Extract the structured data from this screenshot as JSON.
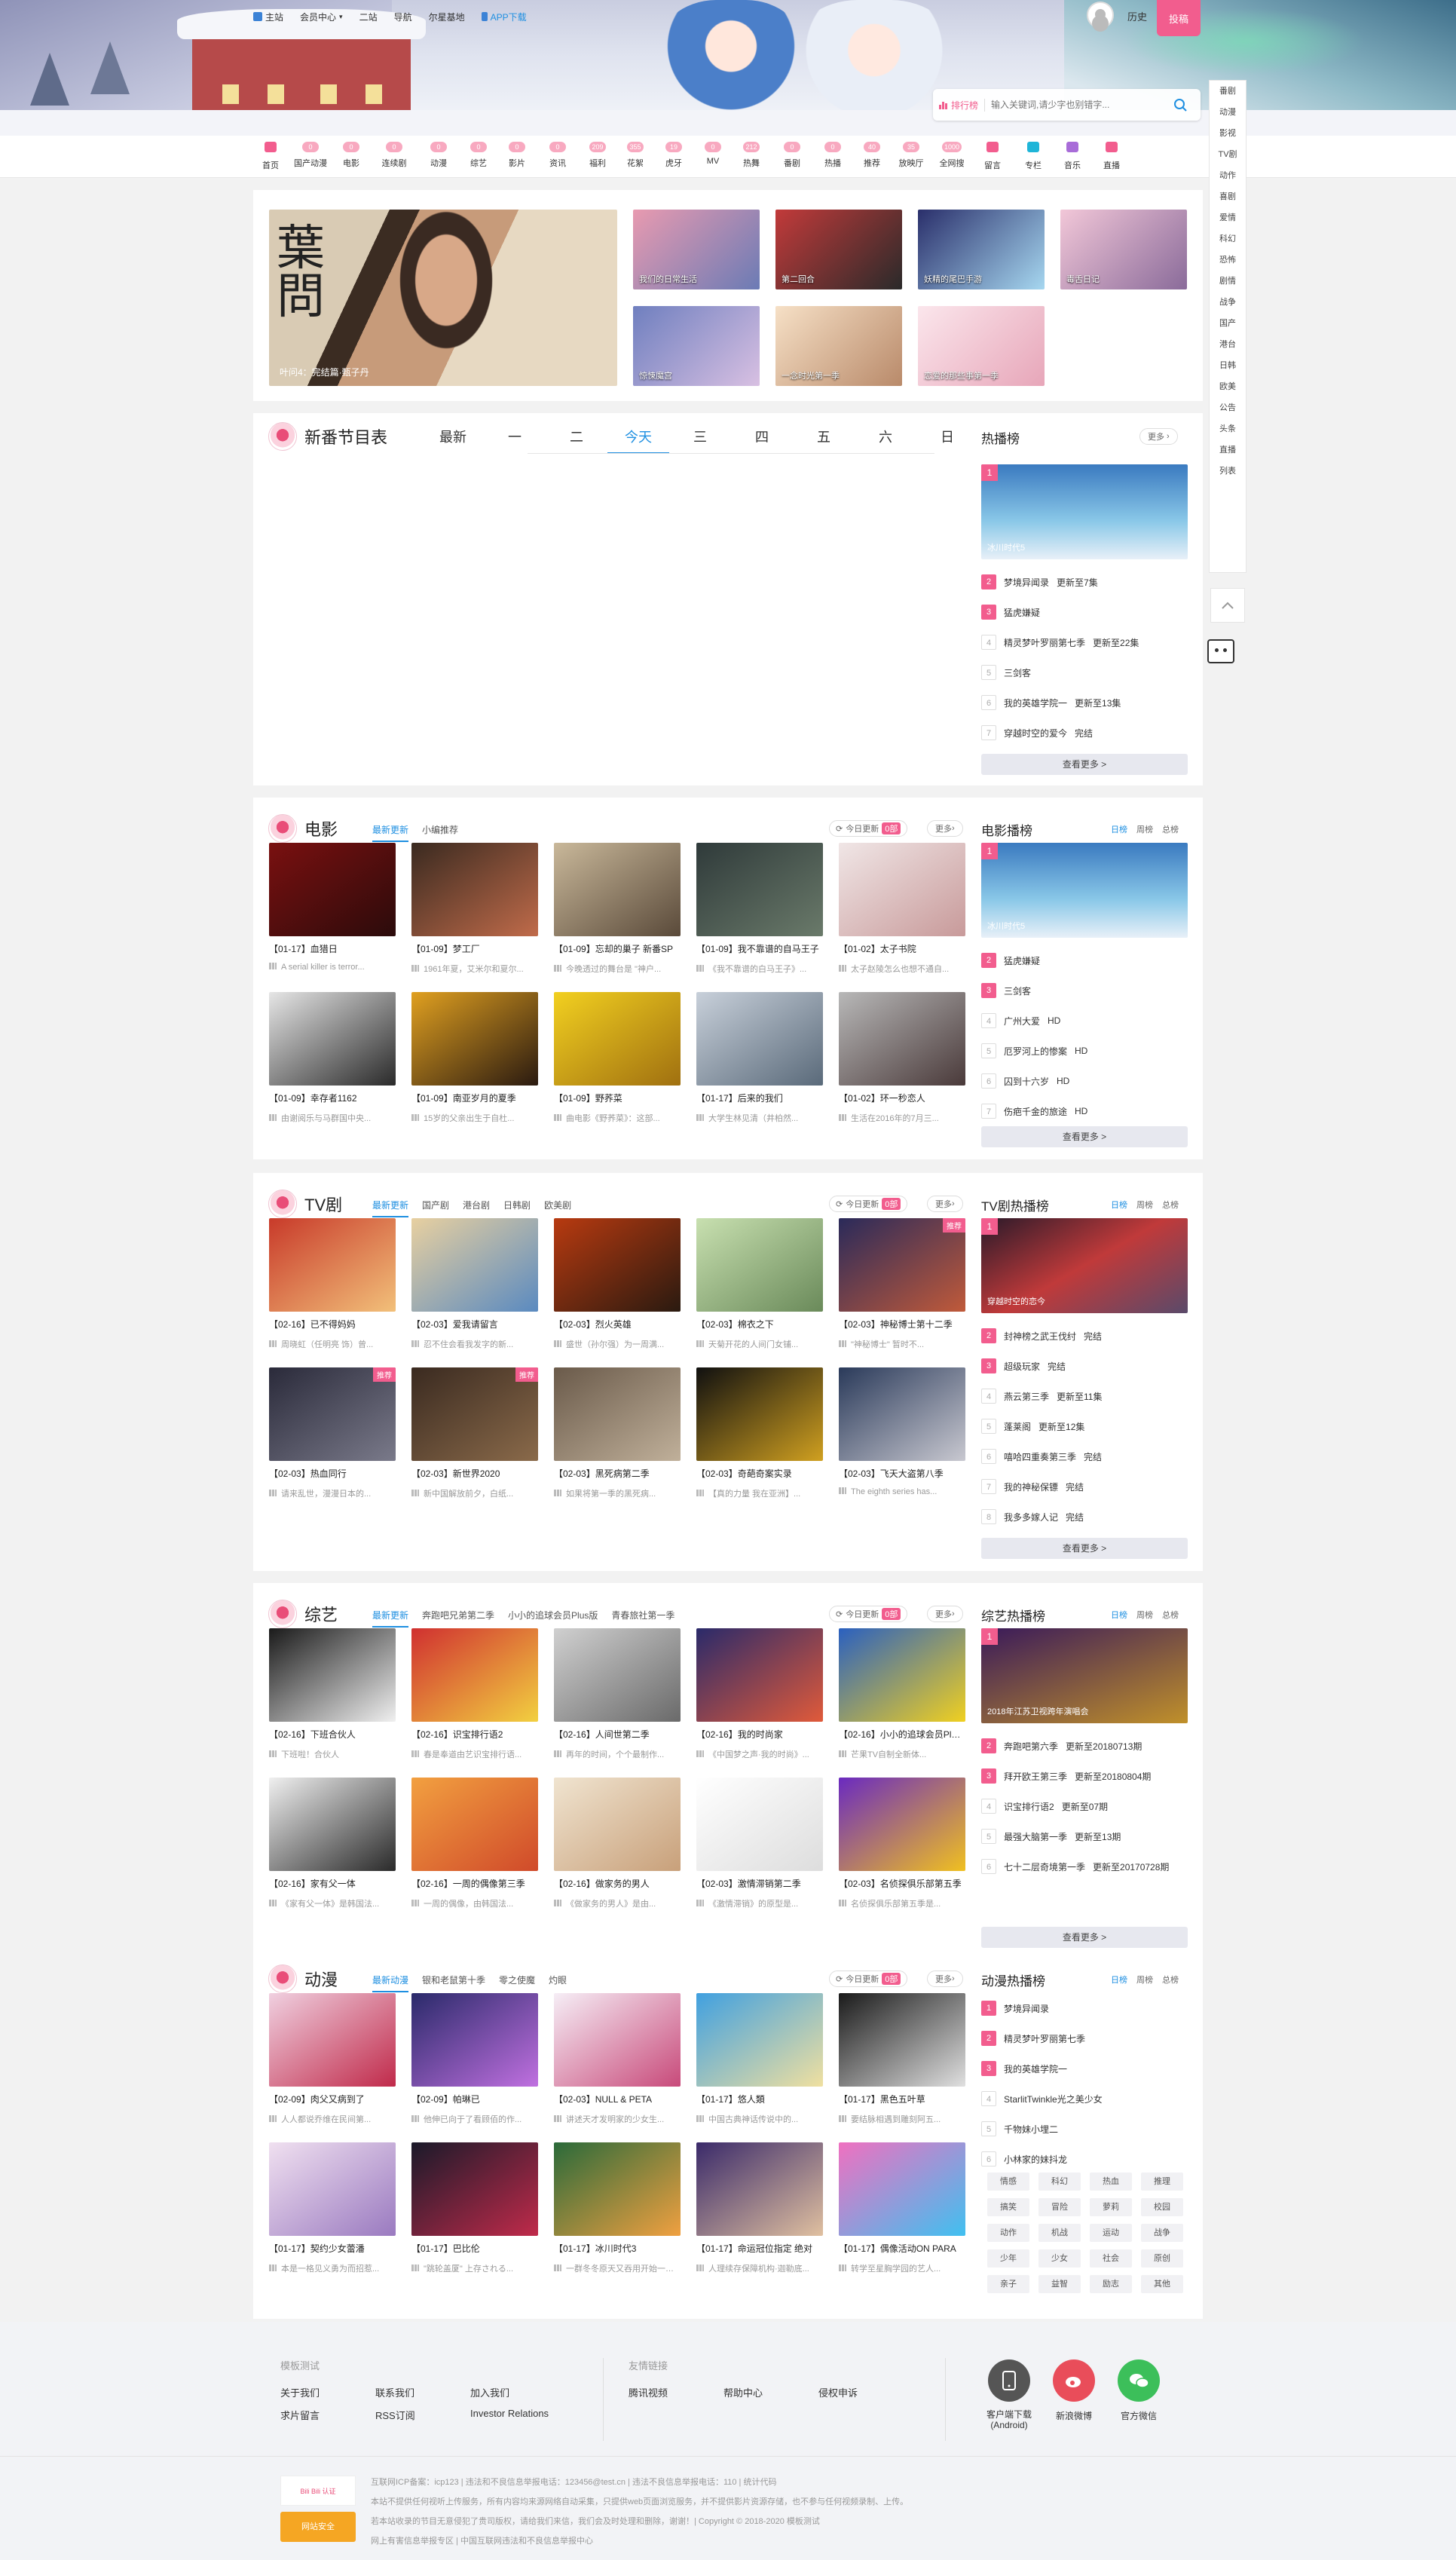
{
  "topnav": [
    {
      "label": "主站",
      "icon": "home-icon"
    },
    {
      "label": "会员中心"
    },
    {
      "label": "二站"
    },
    {
      "label": "导航"
    },
    {
      "label": "尔星基地"
    },
    {
      "label": "APP下载",
      "icon": "phone-icon"
    }
  ],
  "header": {
    "history": "历史",
    "post": "投稿",
    "rank_label": "排行榜",
    "search_placeholder": "输入关键词,请少字也别错字..."
  },
  "categories": [
    {
      "label": "首页",
      "badge": "",
      "color": "#f25d8e"
    },
    {
      "label": "国产动漫",
      "badge": "0",
      "color": ""
    },
    {
      "label": "电影",
      "badge": "0",
      "color": ""
    },
    {
      "label": "连续剧",
      "badge": "0",
      "color": ""
    },
    {
      "label": "动漫",
      "badge": "0",
      "color": ""
    },
    {
      "label": "综艺",
      "badge": "0",
      "color": ""
    },
    {
      "label": "影片",
      "badge": "0",
      "color": ""
    },
    {
      "label": "资讯",
      "badge": "0",
      "color": ""
    },
    {
      "label": "福利",
      "badge": "209",
      "color": ""
    },
    {
      "label": "花絮",
      "badge": "355",
      "color": ""
    },
    {
      "label": "虎牙",
      "badge": "19",
      "color": ""
    },
    {
      "label": "MV",
      "badge": "0",
      "color": ""
    },
    {
      "label": "热舞",
      "badge": "212",
      "color": ""
    },
    {
      "label": "番剧",
      "badge": "0",
      "color": ""
    },
    {
      "label": "热播",
      "badge": "0",
      "color": ""
    },
    {
      "label": "推荐",
      "badge": "40",
      "color": ""
    },
    {
      "label": "放映厅",
      "badge": "35",
      "color": ""
    },
    {
      "label": "全网搜",
      "badge": "1000",
      "color": ""
    },
    {
      "label": "留言",
      "badge": "",
      "color": "#f25d8e"
    },
    {
      "label": "专栏",
      "badge": "",
      "color": "#1fb5d8"
    },
    {
      "label": "音乐",
      "badge": "",
      "color": "#a86cd8"
    },
    {
      "label": "直播",
      "badge": "",
      "color": "#f25d8e"
    }
  ],
  "sidebar": [
    "番剧",
    "动漫",
    "影视",
    "TV剧",
    "动作",
    "喜剧",
    "爱情",
    "科幻",
    "恐怖",
    "剧情",
    "战争",
    "国产",
    "港台",
    "日韩",
    "欧美",
    "公告",
    "头条",
    "直播",
    "列表"
  ],
  "banner": {
    "main": {
      "caption": "叶问4：完结篇·甄子丹",
      "color": "#b58b6a"
    },
    "small": [
      {
        "caption": "我们的日常生活",
        "c1": "#e89ab0",
        "c2": "#6b7bb5"
      },
      {
        "caption": "第二回合",
        "c1": "#c23a3a",
        "c2": "#2a2a2a"
      },
      {
        "caption": "妖精的尾巴手游",
        "c1": "#2a2f6b",
        "c2": "#a6d7f0"
      },
      {
        "caption": "毒舌日记",
        "c1": "#f2c7d8",
        "c2": "#8a6b9a"
      },
      {
        "caption": "惊悚魔宫",
        "c1": "#6f7fbf",
        "c2": "#d8c0e2"
      },
      {
        "caption": "一念时光第一季",
        "c1": "#f6e0c6",
        "c2": "#b98a6a"
      },
      {
        "caption": "恋爱的那些事第一季",
        "c1": "#fbe6ec",
        "c2": "#e7a6b9"
      }
    ]
  },
  "schedule": {
    "title": "新番节目表",
    "tabs": [
      "最新",
      "一",
      "二",
      "今天",
      "三",
      "四",
      "五",
      "六",
      "日"
    ],
    "active": 3
  },
  "hot": {
    "title": "热播榜",
    "more": "更多",
    "top": {
      "caption": "冰川时代5"
    },
    "list": [
      {
        "n": "2",
        "title": "梦境异闻录",
        "ep": "更新至7集"
      },
      {
        "n": "3",
        "title": "猛虎嫌疑",
        "ep": ""
      },
      {
        "n": "4",
        "title": "精灵梦叶罗丽第七季",
        "ep": "更新至22集"
      },
      {
        "n": "5",
        "title": "三剑客",
        "ep": ""
      },
      {
        "n": "6",
        "title": "我的英雄学院一",
        "ep": "更新至13集"
      },
      {
        "n": "7",
        "title": "穿越时空的爱今",
        "ep": "完结"
      }
    ],
    "see_more": "查看更多 >"
  },
  "movie": {
    "title": "电影",
    "tabs": [
      "最新更新",
      "小编推荐"
    ],
    "refresh": "今日更新",
    "count": "0部",
    "more": "更多",
    "rank_title": "电影播榜",
    "rank_tabs": [
      "日榜",
      "周榜",
      "总榜"
    ],
    "items": [
      {
        "title": "【01-17】血猎日",
        "desc": "A serial killer is terror...",
        "c1": "#7a1010",
        "c2": "#2b0b0b",
        "tag": ""
      },
      {
        "title": "【01-09】梦工厂",
        "desc": "1961年夏，艾米尔和夏尔...",
        "c1": "#3a2a20",
        "c2": "#c06b4a",
        "tag": ""
      },
      {
        "title": "【01-09】忘却的巢子 新番SP",
        "desc": "今晚透过的舞台是 \"神户...",
        "c1": "#c9b89a",
        "c2": "#5a4a3a",
        "tag": ""
      },
      {
        "title": "【01-09】我不靠谱的自马王子",
        "desc": "《我不靠谱的白马王子》...",
        "c1": "#2f3a3a",
        "c2": "#6a7a6a",
        "tag": ""
      },
      {
        "title": "【01-02】太子书院",
        "desc": "太子赵陵怎么也想不通自...",
        "c1": "#f0e6e6",
        "c2": "#c89a9a",
        "tag": ""
      },
      {
        "title": "【01-09】幸存者1162",
        "desc": "由谢阅乐与马群国中央...",
        "c1": "#e6e6e6",
        "c2": "#2a2a2a",
        "tag": ""
      },
      {
        "title": "【01-09】南亚岁月的夏季",
        "desc": "15岁的父亲出生于自杜...",
        "c1": "#e0a020",
        "c2": "#2a1a10",
        "tag": ""
      },
      {
        "title": "【01-09】野荞菜",
        "desc": "曲电影《野荞菜》：这部...",
        "c1": "#f2d020",
        "c2": "#a07010",
        "tag": ""
      },
      {
        "title": "【01-17】后来的我们",
        "desc": "大学生林见清（井柏然...",
        "c1": "#c8d0da",
        "c2": "#5a6a7a",
        "tag": ""
      },
      {
        "title": "【01-02】环一秒恋人",
        "desc": "生活在2016年的7月三...",
        "c1": "#b8b8b8",
        "c2": "#4a3a3a",
        "tag": ""
      }
    ],
    "rank_top": {
      "caption": "冰川时代5"
    },
    "rank": [
      {
        "n": "2",
        "title": "猛虎嫌疑",
        "ep": ""
      },
      {
        "n": "3",
        "title": "三剑客",
        "ep": ""
      },
      {
        "n": "4",
        "title": "广州大爱",
        "ep": "HD"
      },
      {
        "n": "5",
        "title": "厄罗河上的惨案",
        "ep": "HD"
      },
      {
        "n": "6",
        "title": "囚到十六岁",
        "ep": "HD"
      },
      {
        "n": "7",
        "title": "伤疤千金的旅途",
        "ep": "HD"
      }
    ],
    "see_more": "查看更多 >"
  },
  "tv": {
    "title": "TV剧",
    "tabs": [
      "最新更新",
      "国产剧",
      "港台剧",
      "日韩剧",
      "欧美剧"
    ],
    "refresh": "今日更新",
    "count": "0部",
    "more": "更多",
    "rank_title": "TV剧热播榜",
    "rank_tabs": [
      "日榜",
      "周榜",
      "总榜"
    ],
    "items": [
      {
        "title": "【02-16】已不得妈妈",
        "desc": "周晓虹（任明亮 饰）曾...",
        "c1": "#c83a2a",
        "c2": "#f2c07a",
        "tag": ""
      },
      {
        "title": "【02-03】爱我请留言",
        "desc": "忍不住会看我发字的新...",
        "c1": "#e8d0a0",
        "c2": "#5a8ac0",
        "tag": ""
      },
      {
        "title": "【02-03】烈火英雄",
        "desc": "盛世（孙尔强）为一周满...",
        "c1": "#b83a10",
        "c2": "#2a1a10",
        "tag": ""
      },
      {
        "title": "【02-03】棉衣之下",
        "desc": "天菊开花的人间门女铺...",
        "c1": "#c8e0b0",
        "c2": "#6a8a5a",
        "tag": ""
      },
      {
        "title": "【02-03】神秘博士第十二季",
        "desc": "\"神秘博士\" 暂时不...",
        "c1": "#2a2a5a",
        "c2": "#c05a3a",
        "tag": "推荐"
      },
      {
        "title": "【02-03】热血同行",
        "desc": "请来乱世，漫漫日本的...",
        "c1": "#2a2a3a",
        "c2": "#7a7a8a",
        "tag": "推荐"
      },
      {
        "title": "【02-03】新世界2020",
        "desc": "新中国解放前夕，白纸...",
        "c1": "#3a2a20",
        "c2": "#8a6a4a",
        "tag": "推荐"
      },
      {
        "title": "【02-03】黑死病第二季",
        "desc": "如果将第一季的黑死病...",
        "c1": "#6a5a4a",
        "c2": "#c0b09a",
        "tag": ""
      },
      {
        "title": "【02-03】奇葩奇案实录",
        "desc": "【真的力量 我在亚洲】...",
        "c1": "#101010",
        "c2": "#d0a020",
        "tag": ""
      },
      {
        "title": "【02-03】飞天大盗第八季",
        "desc": "The eighth series has...",
        "c1": "#2a3a5a",
        "c2": "#c8c8d0",
        "tag": ""
      }
    ],
    "rank_top": {
      "caption": "穿越时空的恋今"
    },
    "rank": [
      {
        "n": "2",
        "title": "封神榜之武王伐纣",
        "ep": "完结"
      },
      {
        "n": "3",
        "title": "超级玩家",
        "ep": "完结"
      },
      {
        "n": "4",
        "title": "燕云第三季",
        "ep": "更新至11集"
      },
      {
        "n": "5",
        "title": "蓬莱阁",
        "ep": "更新至12集"
      },
      {
        "n": "6",
        "title": "嘻哈四重奏第三季",
        "ep": "完结"
      },
      {
        "n": "7",
        "title": "我的神秘保镖",
        "ep": "完结"
      },
      {
        "n": "8",
        "title": "我多多嫁人记",
        "ep": "完结"
      }
    ],
    "see_more": "查看更多 >"
  },
  "variety": {
    "title": "综艺",
    "tabs": [
      "最新更新",
      "奔跑吧兄弟第二季",
      "小小的追球会员Plus版",
      "青春旅社第一季"
    ],
    "refresh": "今日更新",
    "count": "0部",
    "more": "更多",
    "rank_title": "综艺热播榜",
    "rank_tabs": [
      "日榜",
      "周榜",
      "总榜"
    ],
    "items": [
      {
        "title": "【02-16】下班合伙人",
        "desc": "下班啦！合伙人",
        "c1": "#1a1a1a",
        "c2": "#f0f0f0",
        "tag": ""
      },
      {
        "title": "【02-16】识宝排行语2",
        "desc": "春是奉道由艺识宝排行语...",
        "c1": "#d03030",
        "c2": "#f2d040",
        "tag": ""
      },
      {
        "title": "【02-16】人间世第二季",
        "desc": "再年的时间，个个最制作...",
        "c1": "#d0d0d0",
        "c2": "#6a6a6a",
        "tag": ""
      },
      {
        "title": "【02-16】我的时尚家",
        "desc": "《中国梦之声·我的时尚》...",
        "c1": "#2a2a6a",
        "c2": "#e05a3a",
        "tag": ""
      },
      {
        "title": "【02-16】小小的追球会员Plus版",
        "desc": "芒果TV自制全新体...",
        "c1": "#2a60c0",
        "c2": "#f0d020",
        "tag": ""
      },
      {
        "title": "【02-16】家有父一体",
        "desc": "《家有父一体》是韩国法...",
        "c1": "#f0f0f0",
        "c2": "#2a2a2a",
        "tag": ""
      },
      {
        "title": "【02-16】一周的偶像第三季",
        "desc": "一周的偶像，由韩国法...",
        "c1": "#f2a040",
        "c2": "#d04a2a",
        "tag": ""
      },
      {
        "title": "【02-16】做家务的男人",
        "desc": "《做家务的男人》是由...",
        "c1": "#f0e4d0",
        "c2": "#c8a07a",
        "tag": ""
      },
      {
        "title": "【02-03】激情滞销第二季",
        "desc": "《激情滞销》的原型是...",
        "c1": "#ffffff",
        "c2": "#dddddd",
        "tag": ""
      },
      {
        "title": "【02-03】名侦探俱乐部第五季",
        "desc": "名侦探俱乐部第五季是...",
        "c1": "#6a2ac0",
        "c2": "#f0c020",
        "tag": ""
      }
    ],
    "rank_top": {
      "caption": "2018年江苏卫视跨年演唱会"
    },
    "rank": [
      {
        "n": "2",
        "title": "奔跑吧第六季",
        "ep": "更新至20180713期"
      },
      {
        "n": "3",
        "title": "拜开欧王第三季",
        "ep": "更新至20180804期"
      },
      {
        "n": "4",
        "title": "识宝排行语2",
        "ep": "更新至07期"
      },
      {
        "n": "5",
        "title": "最强大脑第一季",
        "ep": "更新至13期"
      },
      {
        "n": "6",
        "title": "七十二层奇境第一季",
        "ep": "更新至20170728期"
      }
    ],
    "see_more": "查看更多 >"
  },
  "anime": {
    "title": "动漫",
    "tabs": [
      "最新动漫",
      "银和老鼠第十季",
      "零之使魔",
      "灼眼"
    ],
    "refresh": "今日更新",
    "count": "0部",
    "more": "更多",
    "rank_title": "动漫热播榜",
    "rank_tabs": [
      "日榜",
      "周榜",
      "总榜"
    ],
    "items": [
      {
        "title": "【02-09】肉父又病到了",
        "desc": "人人都说乔维在民间第...",
        "c1": "#f0d0e0",
        "c2": "#c02a4a",
        "tag": ""
      },
      {
        "title": "【02-09】帕琳已",
        "desc": "他伸已向于了看顾佰的作...",
        "c1": "#2a2a6a",
        "c2": "#c070e0",
        "tag": ""
      },
      {
        "title": "【02-03】NULL & PETA",
        "desc": "讲述天才发明家的少女生...",
        "c1": "#f6eef6",
        "c2": "#c84a7a",
        "tag": ""
      },
      {
        "title": "【01-17】悠人類",
        "desc": "中国古典神话传说中的...",
        "c1": "#40a0e0",
        "c2": "#f0e0a0",
        "tag": ""
      },
      {
        "title": "【01-17】黑色五叶草",
        "desc": "要结脉相遇到雕刻阿五...",
        "c1": "#1a1a1a",
        "c2": "#e0e0e0",
        "tag": ""
      },
      {
        "title": "【01-17】契约少女蕾潘",
        "desc": "本是一格见义勇为而招惹...",
        "c1": "#f0e0f0",
        "c2": "#9a7ac0",
        "tag": ""
      },
      {
        "title": "【01-17】巴比伦",
        "desc": "\"跳轮盖厦\" 上存される...",
        "c1": "#1a1a2a",
        "c2": "#c02a4a",
        "tag": ""
      },
      {
        "title": "【01-17】冰川时代3",
        "desc": "一群冬冬原天又吞用开始一段...",
        "c1": "#2a6a3a",
        "c2": "#f0a040",
        "tag": ""
      },
      {
        "title": "【01-17】命运冠位指定 绝对",
        "desc": "人理续存保障机构·迦勒底...",
        "c1": "#3a2a6a",
        "c2": "#e0c0a0",
        "tag": ""
      },
      {
        "title": "【01-17】偶像活动ON PARA",
        "desc": "转学至星胸学园的艺人...",
        "c1": "#f070c0",
        "c2": "#40c0f0",
        "tag": ""
      }
    ],
    "rank": [
      {
        "n": "1",
        "title": "梦境异闻录",
        "ep": ""
      },
      {
        "n": "2",
        "title": "精灵梦叶罗丽第七季",
        "ep": ""
      },
      {
        "n": "3",
        "title": "我的英雄学院一",
        "ep": ""
      },
      {
        "n": "4",
        "title": "StarlitTwinkle光之美少女",
        "ep": ""
      },
      {
        "n": "5",
        "title": "千物妹小埋二",
        "ep": ""
      },
      {
        "n": "6",
        "title": "小林家的妹抖龙",
        "ep": ""
      }
    ],
    "tags": [
      "情感",
      "科幻",
      "热血",
      "推理",
      "搞笑",
      "冒险",
      "萝莉",
      "校园",
      "动作",
      "机战",
      "运动",
      "战争",
      "少年",
      "少女",
      "社会",
      "原创",
      "亲子",
      "益智",
      "励志",
      "其他"
    ]
  },
  "footer": {
    "col1_title": "模板测试",
    "col1": [
      "关于我们",
      "联系我们",
      "加入我们",
      "求片留言",
      "RSS订阅",
      "Investor Relations"
    ],
    "col2_title": "友情链接",
    "col2": [
      "腾讯视频",
      "帮助中心",
      "侵权申诉"
    ],
    "apps": [
      {
        "label": "客户端下载\n(Android)",
        "color": "#555555"
      },
      {
        "label": "新浪微博",
        "color": "#e94d5a"
      },
      {
        "label": "官方微信",
        "color": "#3cbf5a"
      }
    ],
    "copy1": "互联网ICP备案：icp123 | 违法和不良信息举报电话：123456@test.cn | 违法不良信息举报电话：110 | 统计代码",
    "copy2": "本站不提供任何视听上传服务，所有内容均来源网络自动采集，只提供web页面浏览服务，并不提供影片资源存储，也不参与任何视频录制、上传。",
    "copy3": "若本站收录的节目无意侵犯了贵司版权，请给我们来信，我们会及时处理和删除，谢谢！| Copyright © 2018-2020 模板测试",
    "copy4": "网上有害信息举报专区 | 中国互联网违法和不良信息举报中心",
    "badge1": "Bili Bili 认证",
    "badge2": "网站安全"
  }
}
